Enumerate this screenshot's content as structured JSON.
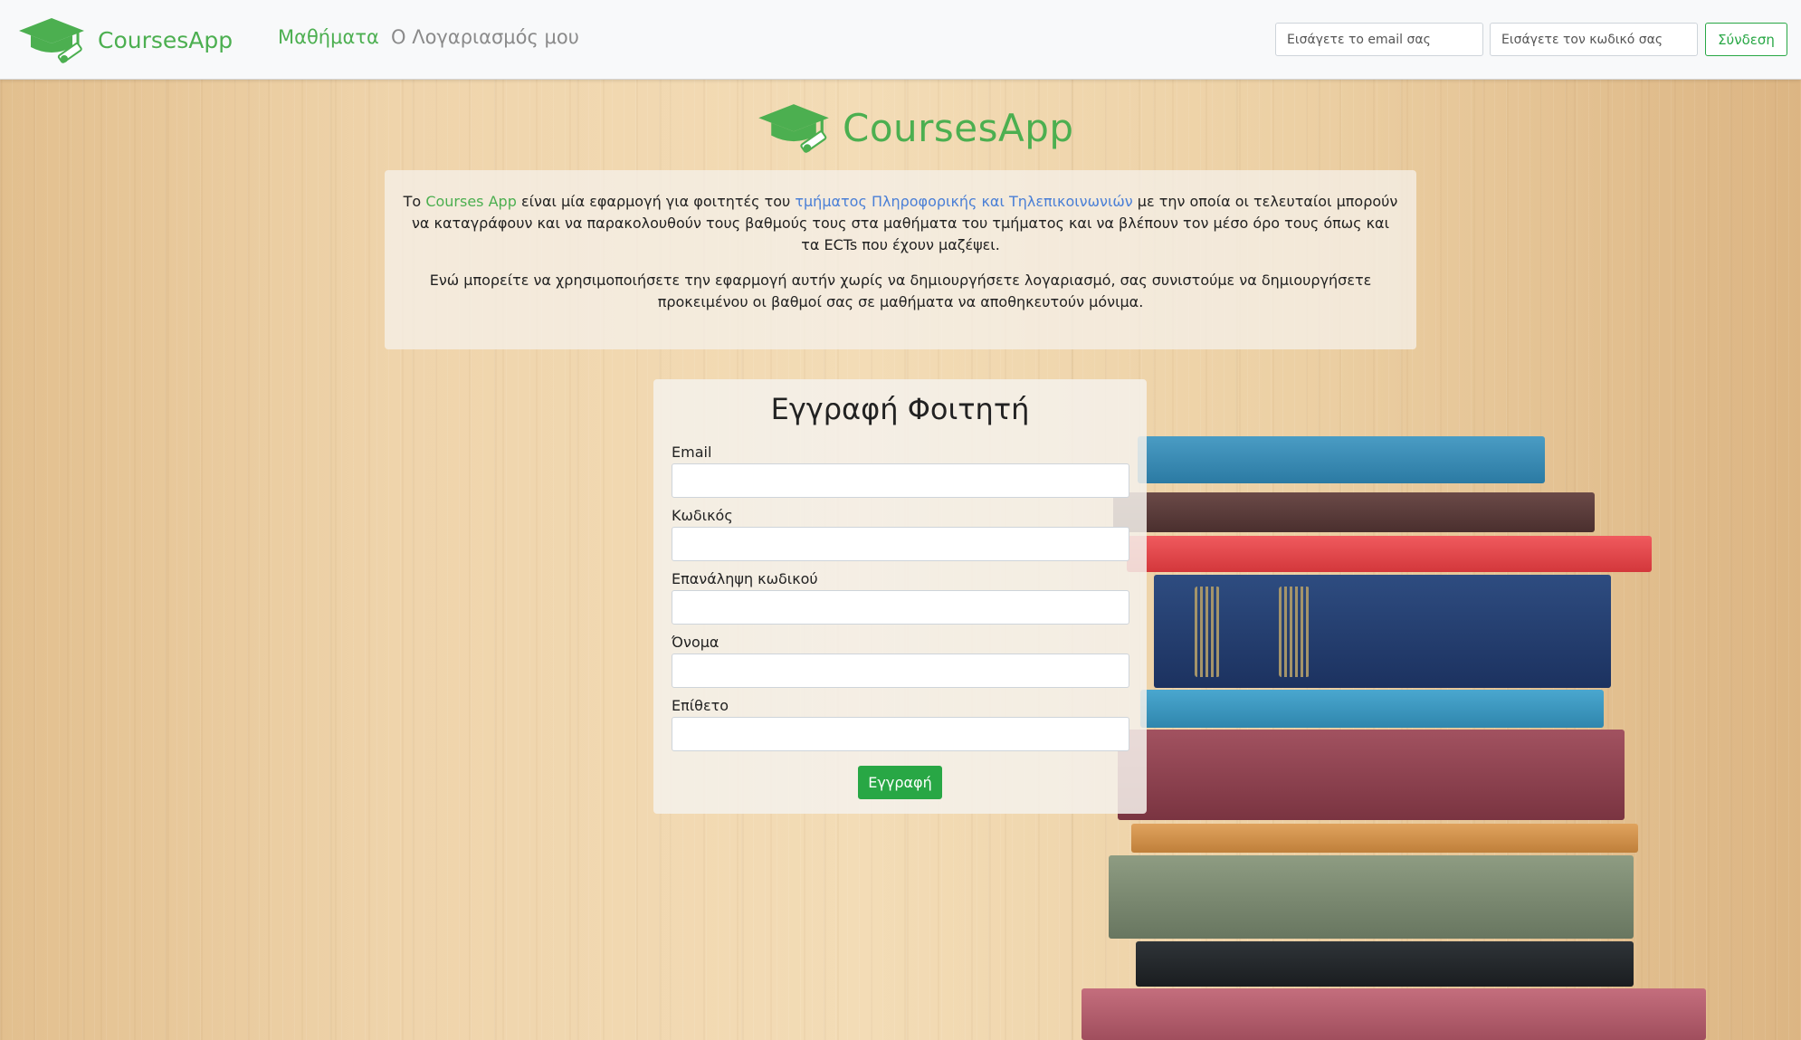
{
  "navbar": {
    "brand": "CoursesApp",
    "links": [
      {
        "label": "Μαθήματα"
      },
      {
        "label": "Ο Λογαριασμός μου"
      }
    ],
    "email_placeholder": "Εισάγετε το email σας",
    "password_placeholder": "Εισάγετε τον κωδικό σας",
    "login_label": "Σύνδεση"
  },
  "hero": {
    "title": "CoursesApp"
  },
  "info": {
    "p1_prefix": "Το ",
    "p1_app": "Courses App",
    "p1_mid": " είναι μία εφαρμογή για φοιτητές του ",
    "p1_dept": "τμήματος Πληροφορικής και Τηλεπικοινωνιών",
    "p1_suffix": " με την οποία οι τελευταίοι μπορούν να καταγράφουν και να παρακολουθούν τους βαθμούς τους στα μαθήματα του τμήματος και να βλέπουν τον μέσο όρο τους όπως και τα ECTs που έχουν μαζέψει.",
    "p2": "Ενώ μπορείτε να χρησιμοποιήσετε την εφαρμογή αυτήν χωρίς να δημιουργήσετε λογαριασμό, σας συνιστούμε να δημιουργήσετε προκειμένου οι βαθμοί σας σε μαθήματα να αποθηκευτούν μόνιμα."
  },
  "form": {
    "title": "Εγγραφή Φοιτητή",
    "fields": [
      {
        "label": "Email"
      },
      {
        "label": "Κωδικός"
      },
      {
        "label": "Επανάληψη κωδικού"
      },
      {
        "label": "Όνομα"
      },
      {
        "label": "Επίθετο"
      }
    ],
    "submit_label": "Εγγραφή"
  },
  "colors": {
    "brand_green": "#4caf50",
    "button_green": "#28a745",
    "link_blue": "#4a7fd6"
  },
  "icons": {
    "logo": "graduation-cap-icon"
  }
}
